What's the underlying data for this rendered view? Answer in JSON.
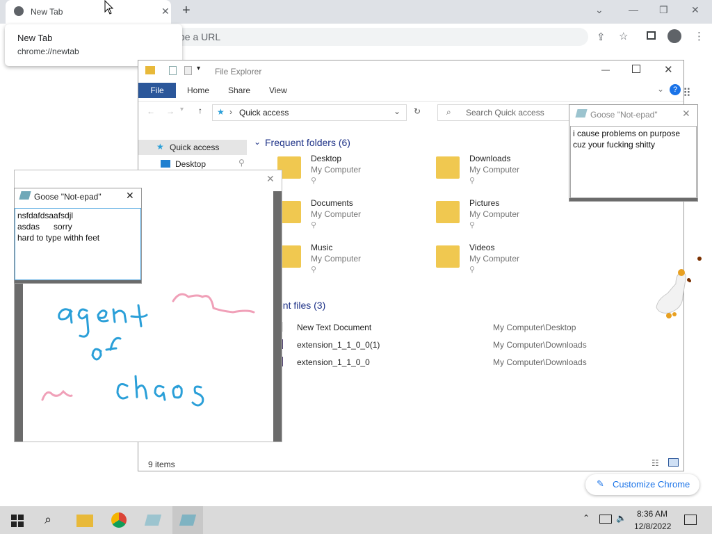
{
  "chrome": {
    "tab_title": "New Tab",
    "hovercard_title": "New Tab",
    "hovercard_url": "chrome://newtab",
    "omnibox_placeholder": "pe a URL",
    "customize_label": "Customize Chrome"
  },
  "explorer": {
    "title": "File Explorer",
    "ribbon_tabs": [
      "File",
      "Home",
      "Share",
      "View"
    ],
    "address": "Quick access",
    "search_placeholder": "Search Quick access",
    "nav": [
      "Quick access",
      "Desktop"
    ],
    "frequent_header": "Frequent folders (6)",
    "folders": [
      {
        "name": "Desktop",
        "sub": "My Computer"
      },
      {
        "name": "Downloads",
        "sub": "My Computer"
      },
      {
        "name": "Documents",
        "sub": "My Computer"
      },
      {
        "name": "Pictures",
        "sub": "My Computer"
      },
      {
        "name": "Music",
        "sub": "My Computer"
      },
      {
        "name": "Videos",
        "sub": "My Computer"
      }
    ],
    "recent_header": "ent files (3)",
    "recent": [
      {
        "name": "New Text Document",
        "path": "My Computer\\Desktop"
      },
      {
        "name": "extension_1_1_0_0(1)",
        "path": "My Computer\\Downloads"
      },
      {
        "name": "extension_1_1_0_0",
        "path": "My Computer\\Downloads"
      }
    ],
    "status": "9 items"
  },
  "goose_left": {
    "title": "Goose \"Not-epad\"",
    "text": "nsfdafdsaafsdjl\nasdas      sorry\nhard to type withh feet"
  },
  "goose_right": {
    "title": "Goose \"Not-epad\"",
    "text": "i cause problems on purpose\ncuz your fucking shitty"
  },
  "taskbar": {
    "time": "8:36 AM",
    "date": "12/8/2022"
  },
  "colors": {
    "accent": "#1a73e8",
    "file_tab": "#2b579a",
    "scribble_blue": "#2a9fd8",
    "scribble_pink": "#f0a0b8"
  }
}
